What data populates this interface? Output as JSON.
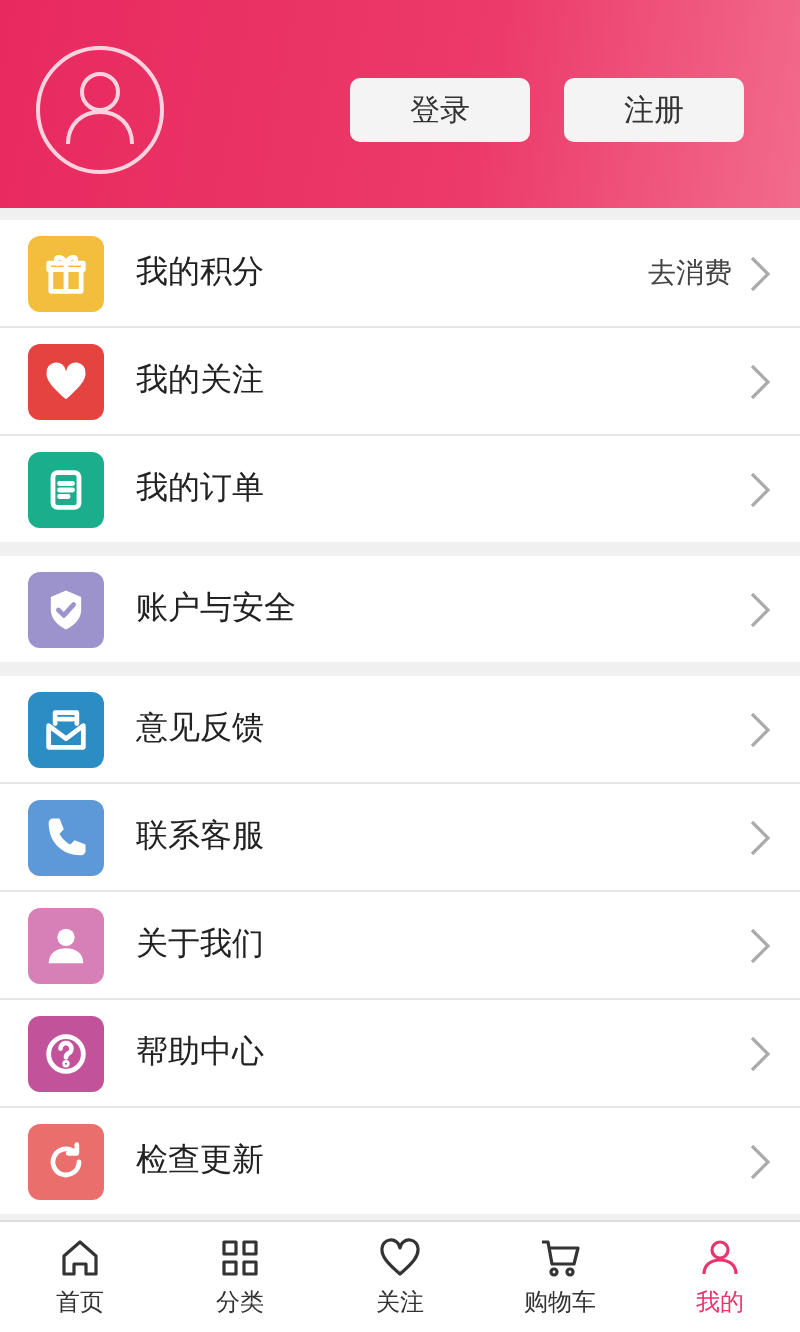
{
  "header": {
    "buttons": [
      "登录",
      "注册"
    ]
  },
  "groups": [
    {
      "items": [
        {
          "label": "我的积分",
          "action": "去消费",
          "kind": "gift",
          "color": "#f3bd3e"
        },
        {
          "label": "我的关注",
          "kind": "heart",
          "color": "#e5433f"
        },
        {
          "label": "我的订单",
          "kind": "document",
          "color": "#1aae8c"
        }
      ]
    },
    {
      "items": [
        {
          "label": "账户与安全",
          "kind": "shield",
          "color": "#9d93cc"
        }
      ]
    },
    {
      "items": [
        {
          "label": "意见反馈",
          "kind": "mail",
          "color": "#2c8cc4"
        },
        {
          "label": "联系客服",
          "kind": "phone",
          "color": "#5d98d8"
        },
        {
          "label": "关于我们",
          "kind": "person",
          "color": "#d77fb7"
        },
        {
          "label": "帮助中心",
          "kind": "question",
          "color": "#c2539b"
        },
        {
          "label": "检查更新",
          "kind": "refresh",
          "color": "#ea6f6c"
        }
      ]
    }
  ],
  "tabs": [
    {
      "label": "首页",
      "kind": "home",
      "selected": false
    },
    {
      "label": "分类",
      "kind": "grid",
      "selected": false
    },
    {
      "label": "关注",
      "kind": "heart",
      "selected": false
    },
    {
      "label": "购物车",
      "kind": "cart",
      "selected": false
    },
    {
      "label": "我的",
      "kind": "person",
      "selected": true
    }
  ]
}
